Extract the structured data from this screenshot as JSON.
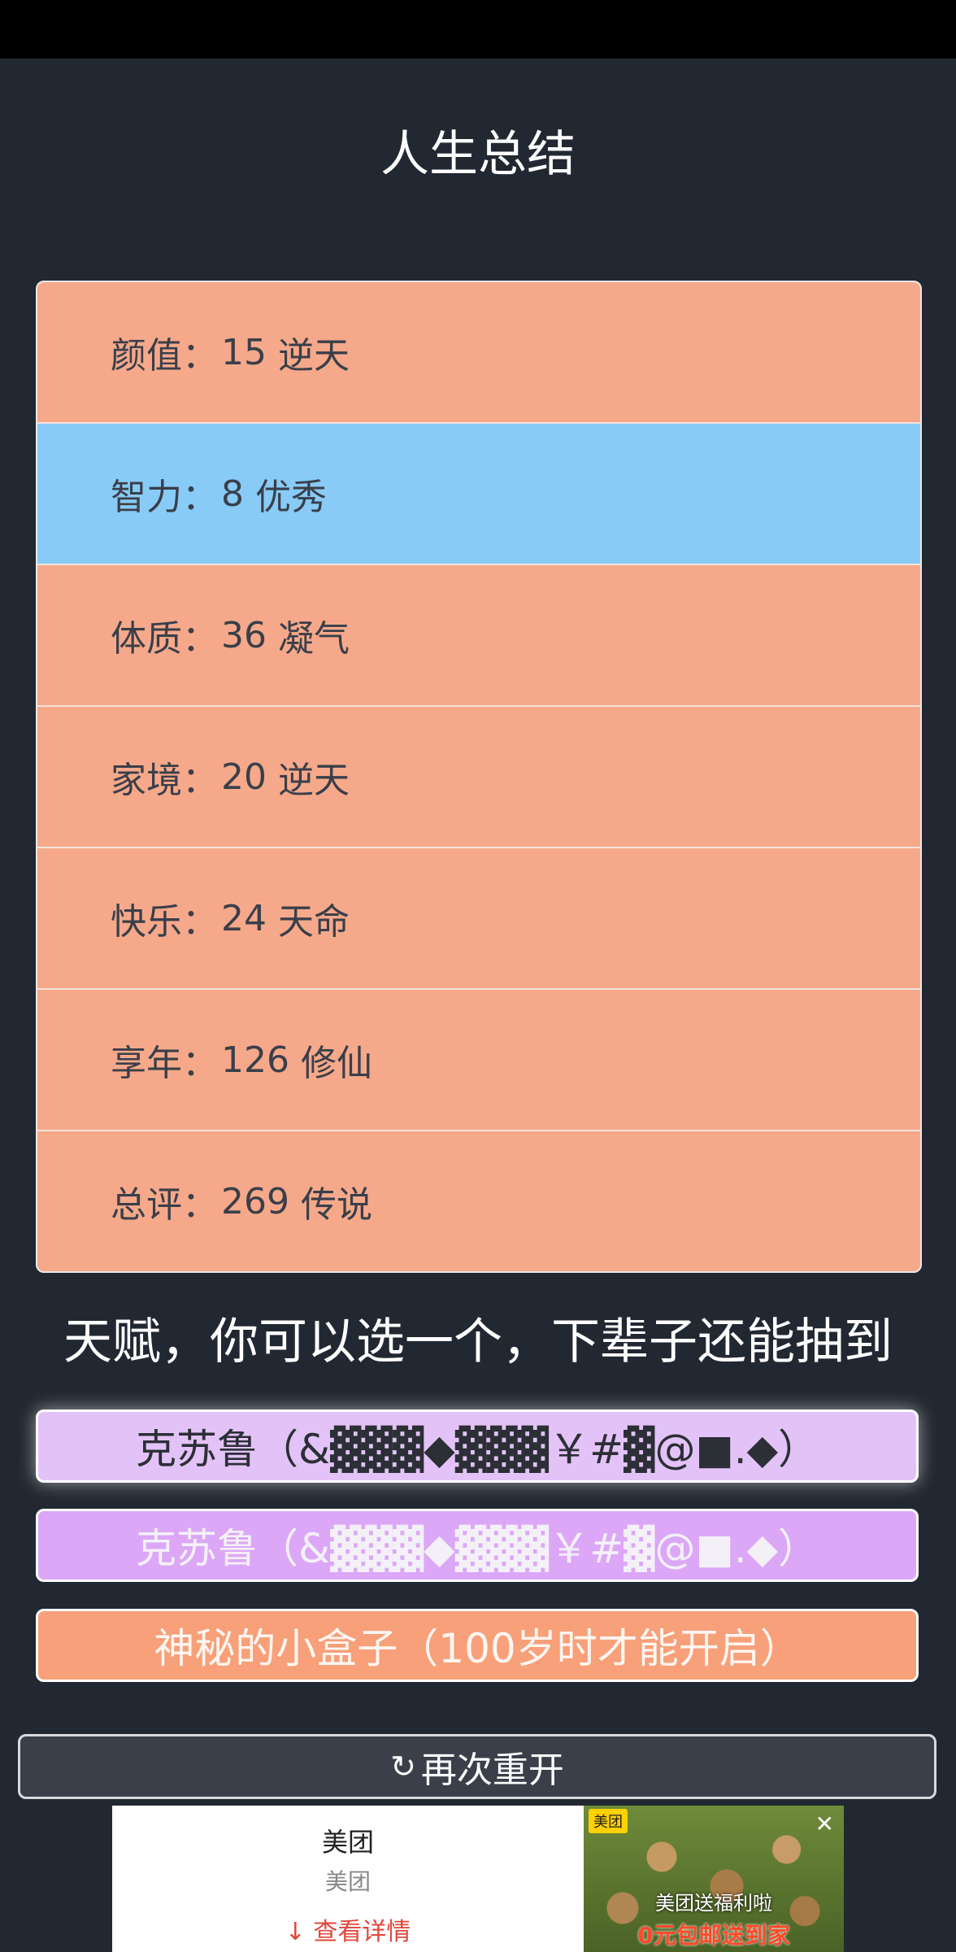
{
  "page": {
    "title": "人生总结"
  },
  "summary": {
    "rows": [
      {
        "label": "颜值",
        "value": "15",
        "grade": "逆天"
      },
      {
        "label": "智力",
        "value": "8",
        "grade": "优秀"
      },
      {
        "label": "体质",
        "value": "36",
        "grade": "凝气"
      },
      {
        "label": "家境",
        "value": "20",
        "grade": "逆天"
      },
      {
        "label": "快乐",
        "value": "24",
        "grade": "天命"
      },
      {
        "label": "享年",
        "value": "126",
        "grade": "修仙"
      },
      {
        "label": "总评",
        "value": "269",
        "grade": "传说"
      }
    ]
  },
  "talents": {
    "title": "天赋，你可以选一个，下辈子还能抽到",
    "options": [
      "克苏鲁（&▓▓▓◆▓▓▓￥#▓@■.◆）",
      "克苏鲁（&▓▓▓◆▓▓▓￥#▓@■.◆）",
      "神秘的小盒子（100岁时才能开启）"
    ]
  },
  "restart": {
    "icon": "refresh-icon",
    "label": "再次重开"
  },
  "ad": {
    "brand": "美团",
    "subtitle": "美团",
    "detail": "查看详情",
    "tag": "美团",
    "caption_line1": "美团送福利啦",
    "caption_line2": "0元包邮送到家"
  }
}
